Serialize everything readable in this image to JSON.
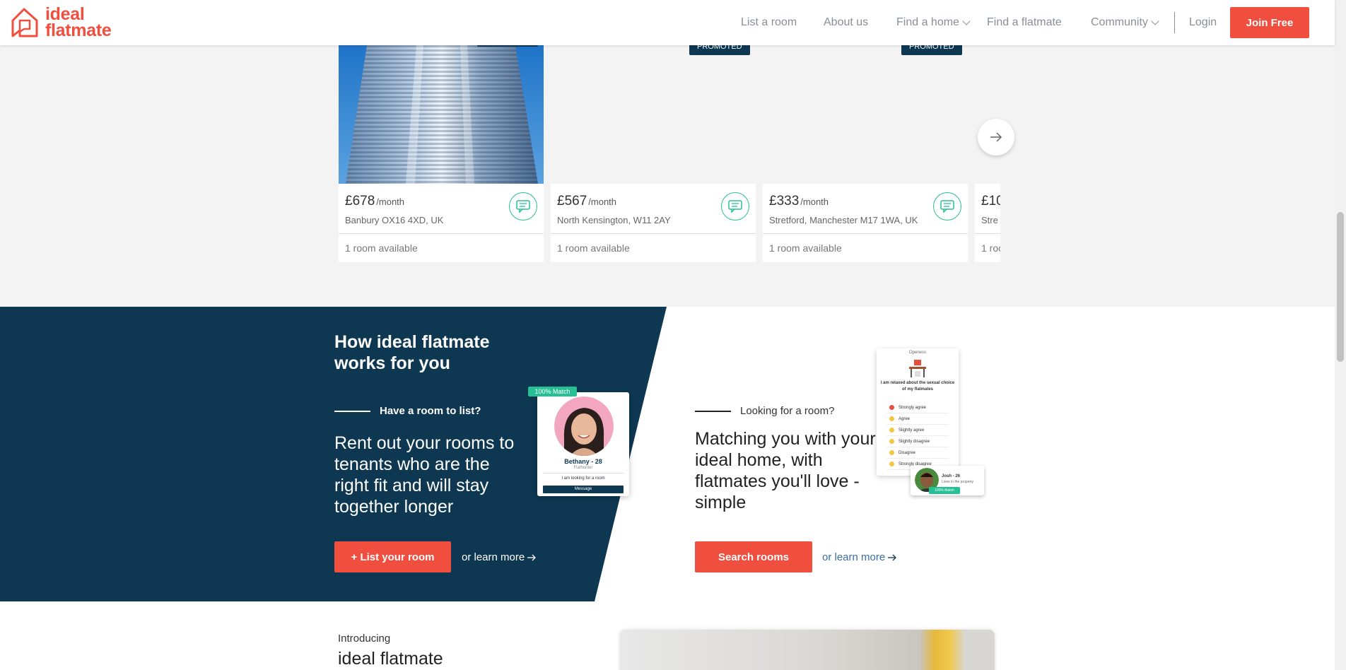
{
  "header": {
    "logo_line1": "ideal",
    "logo_line2": "flatmate",
    "nav": {
      "list_room": "List a room",
      "about": "About us",
      "find_home": "Find a home",
      "find_flatmate": "Find a flatmate",
      "community": "Community",
      "login": "Login"
    },
    "join_label": "Join Free"
  },
  "listings": {
    "badge_label": "PROMOTED",
    "per_month": "/month",
    "cards": [
      {
        "price": "£678",
        "address": "Banbury OX16 4XD, UK",
        "rooms": "1 room available"
      },
      {
        "price": "£567",
        "address": "North Kensington, W11 2AY",
        "rooms": "1 room available"
      },
      {
        "price": "£333",
        "address": "Stretford, Manchester M17 1WA, UK",
        "rooms": "1 room available"
      },
      {
        "price": "£10",
        "address": "Stre",
        "rooms": "1 roo"
      }
    ]
  },
  "how": {
    "title": "How ideal flatmate works for you",
    "left": {
      "subtitle": "Have a room to list?",
      "headline": "Rent out your rooms to tenants who are the right fit and will stay together longer",
      "button": "+ List your room",
      "learn": "or learn more"
    },
    "right": {
      "subtitle": "Looking for a room?",
      "headline": "Matching you with your ideal home, with flatmates you'll love - simple",
      "button": "Search rooms",
      "learn": "or learn more"
    },
    "match_card": {
      "pill": "100% Match",
      "name": "Bethany - 28",
      "role": "Flathunter",
      "looking": "I am looking for a room",
      "button": "Message"
    },
    "survey": {
      "heading": "Openess",
      "question": "I am relaxed about the sexual choice of my flatmates",
      "options": [
        "Strongly agree",
        "Agree",
        "Slightly agree",
        "Slightly disagree",
        "Disagree",
        "Strongly disagree"
      ]
    },
    "josh_card": {
      "name": "Josh - 26",
      "role": "Lives in the property",
      "pill": "100% Match"
    }
  },
  "intro": {
    "label": "Introducing",
    "title": "ideal flatmate"
  },
  "colors": {
    "brand_red": "#f04e3e",
    "navy": "#0e3752",
    "green": "#27c095"
  }
}
